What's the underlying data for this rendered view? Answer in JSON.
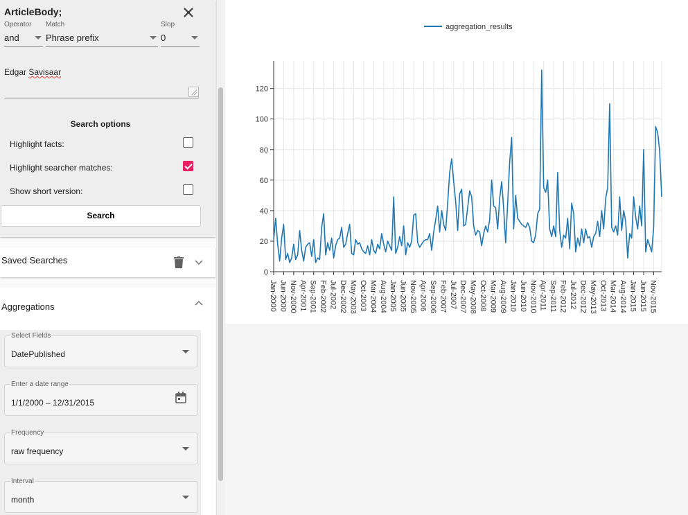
{
  "search": {
    "field_title": "ArticleBody;",
    "operator_label": "Operator",
    "operator_value": "and",
    "match_label": "Match",
    "match_value": "Phrase prefix",
    "slop_label": "Slop",
    "slop_value": "0",
    "query_word1": "Edgar",
    "query_word2": "Savisaar"
  },
  "search_options": {
    "title": "Search options",
    "items": [
      {
        "label": "Highlight facts:",
        "checked": false
      },
      {
        "label": "Highlight searcher matches:",
        "checked": true
      },
      {
        "label": "Show short version:",
        "checked": false
      }
    ],
    "search_button": "Search"
  },
  "saved_searches": {
    "title": "Saved Searches"
  },
  "aggregations": {
    "title": "Aggregations",
    "fields": [
      {
        "label": "Select Fields",
        "value": "DatePublished"
      },
      {
        "label": "Enter a date range",
        "value": "1/1/2000 – 12/31/2015"
      },
      {
        "label": "Frequency",
        "value": "raw frequency"
      },
      {
        "label": "Interval",
        "value": "month"
      }
    ]
  },
  "colors": {
    "accent": "#e91e63",
    "line": "#1f77b4"
  },
  "icons": [
    "close-icon",
    "trash-icon",
    "chevron-down-icon",
    "chevron-up-icon",
    "calendar-icon",
    "dropdown-arrow-icon"
  ],
  "chart_data": {
    "type": "line",
    "legend": "aggregation_results",
    "legend_position": "top-center",
    "grid": true,
    "ylim": [
      0,
      138
    ],
    "yticks": [
      0,
      20,
      40,
      60,
      80,
      100,
      120
    ],
    "x_start": "Jan-2000",
    "x_end": "Dec-2015",
    "xtick_labels": [
      "Jan-2000",
      "Jun-2000",
      "Nov-2000",
      "Apr-2001",
      "Sep-2001",
      "Feb-2002",
      "Jul-2002",
      "Dec-2002",
      "May-2003",
      "Oct-2003",
      "Mar-2004",
      "Aug-2004",
      "Jan-2005",
      "Jun-2005",
      "Nov-2005",
      "Apr-2006",
      "Sep-2006",
      "Feb-2007",
      "Jul-2007",
      "Dec-2007",
      "May-2008",
      "Oct-2008",
      "Mar-2009",
      "Aug-2009",
      "Jan-2010",
      "Jun-2010",
      "Nov-2010",
      "Apr-2011",
      "Sep-2011",
      "Feb-2012",
      "Jul-2012",
      "Dec-2012",
      "May-2013",
      "Oct-2013",
      "Mar-2014",
      "Aug-2014",
      "Jan-2015",
      "Jun-2015",
      "Nov-2015"
    ],
    "values": [
      21,
      35,
      18,
      7,
      22,
      31,
      8,
      12,
      6,
      9,
      18,
      8,
      11,
      27,
      14,
      7,
      16,
      18,
      19,
      10,
      21,
      6,
      9,
      8,
      29,
      38,
      11,
      19,
      14,
      22,
      9,
      17,
      21,
      22,
      29,
      16,
      18,
      25,
      31,
      12,
      11,
      21,
      18,
      19,
      15,
      13,
      12,
      17,
      11,
      21,
      14,
      12,
      18,
      15,
      25,
      18,
      13,
      20,
      17,
      14,
      49,
      12,
      16,
      23,
      17,
      30,
      11,
      19,
      16,
      20,
      37,
      38,
      19,
      16,
      18,
      20,
      21,
      21,
      25,
      14,
      26,
      34,
      43,
      26,
      40,
      31,
      27,
      45,
      65,
      74,
      59,
      46,
      27,
      51,
      54,
      30,
      31,
      42,
      53,
      49,
      30,
      24,
      27,
      26,
      17,
      25,
      30,
      26,
      34,
      60,
      43,
      42,
      28,
      48,
      59,
      41,
      19,
      45,
      72,
      88,
      28,
      50,
      35,
      33,
      31,
      30,
      29,
      32,
      29,
      20,
      19,
      24,
      38,
      41,
      132,
      55,
      52,
      60,
      28,
      23,
      30,
      23,
      65,
      27,
      16,
      24,
      22,
      35,
      15,
      45,
      38,
      13,
      22,
      17,
      28,
      19,
      28,
      22,
      23,
      16,
      23,
      25,
      33,
      23,
      40,
      28,
      48,
      55,
      110,
      29,
      26,
      30,
      24,
      49,
      27,
      40,
      33,
      9,
      25,
      22,
      49,
      36,
      28,
      43,
      30,
      80,
      13,
      21,
      17,
      13,
      29,
      95,
      91,
      79,
      49
    ]
  }
}
